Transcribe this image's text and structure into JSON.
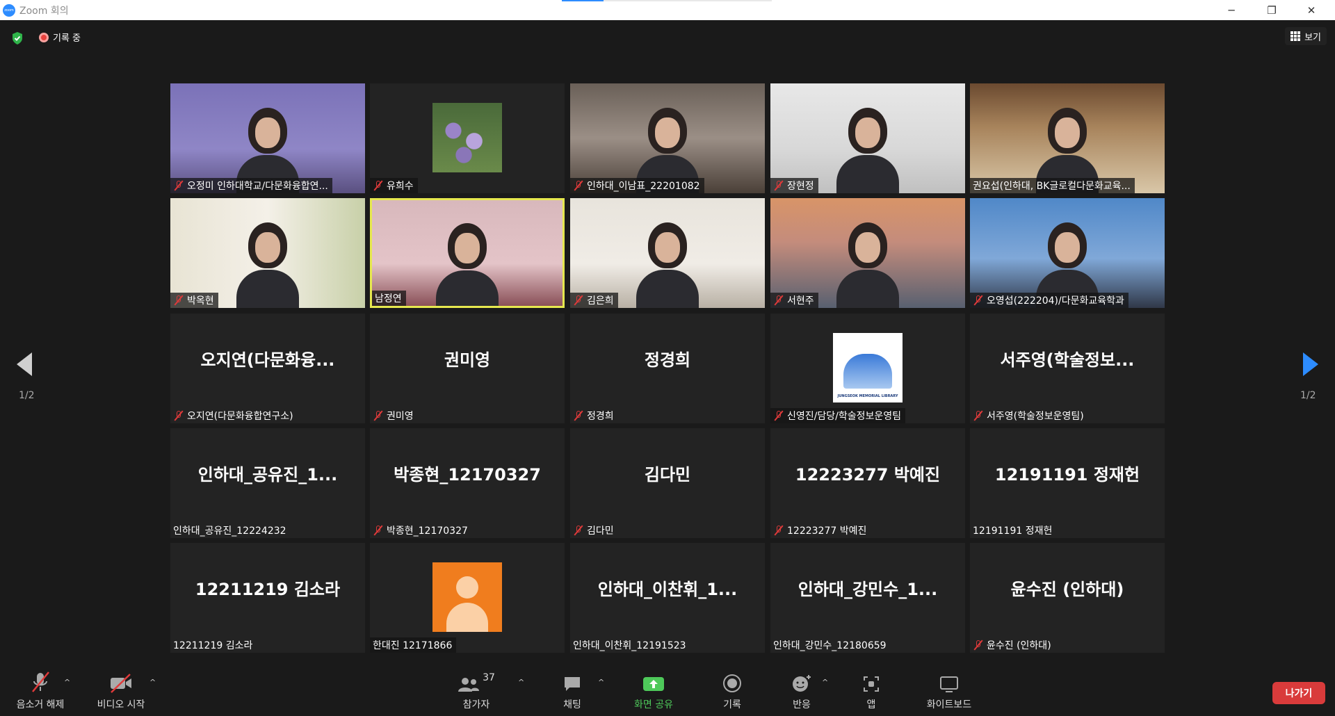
{
  "window": {
    "title": "Zoom 회의"
  },
  "topbar": {
    "recording_label": "기록 중",
    "view_label": "보기"
  },
  "pagination": {
    "left": "1/2",
    "right": "1/2"
  },
  "tiles": [
    {
      "label": "오정미 인하대학교/다문화융합연...",
      "muted": true,
      "video": true
    },
    {
      "label": "유희수",
      "muted": true,
      "image": "wisteria"
    },
    {
      "label": "인하대_이남표_22201082",
      "muted": true,
      "video": true
    },
    {
      "label": "장현정",
      "muted": true,
      "video": true
    },
    {
      "label": "권요섭(인하대, BK글로컬다문화교육...",
      "muted": false,
      "video": true
    },
    {
      "label": "박옥현",
      "muted": true,
      "video": true
    },
    {
      "label": "남정연",
      "muted": false,
      "video": true,
      "active": true
    },
    {
      "label": "김은희",
      "muted": true,
      "video": true
    },
    {
      "label": "서현주",
      "muted": true,
      "video": true
    },
    {
      "label": "오영섭(222204)/다문화교육학과",
      "muted": true,
      "video": true
    },
    {
      "center": "오지연(다문화융...",
      "label": "오지연(다문화융합연구소)",
      "muted": true
    },
    {
      "center": "권미영",
      "label": "권미영",
      "muted": true
    },
    {
      "center": "정경희",
      "label": "정경희",
      "muted": true
    },
    {
      "label": "신영진/담당/학술정보운영팀",
      "muted": true,
      "image": "library-logo",
      "logo_text": "JUNGSEOK MEMORIAL LIBRARY"
    },
    {
      "center": "서주영(학술정보...",
      "label": "서주영(학술정보운영팀)",
      "muted": true
    },
    {
      "center": "인하대_공유진_1...",
      "label": "인하대_공유진_12224232",
      "muted": false
    },
    {
      "center": "박종현_12170327",
      "label": "박종현_12170327",
      "muted": true
    },
    {
      "center": "김다민",
      "label": "김다민",
      "muted": true
    },
    {
      "center": "12223277 박예진",
      "label": "12223277 박예진",
      "muted": true
    },
    {
      "center": "12191191 정재헌",
      "label": "12191191 정재헌",
      "muted": false
    },
    {
      "center": "12211219 김소라",
      "label": "12211219 김소라",
      "muted": false
    },
    {
      "label": "한대진 12171866",
      "muted": false,
      "image": "avatar"
    },
    {
      "center": "인하대_이찬휘_1...",
      "label": "인하대_이찬휘_12191523",
      "muted": false
    },
    {
      "center": "인하대_강민수_1...",
      "label": "인하대_강민수_12180659",
      "muted": false
    },
    {
      "center": "윤수진 (인하대)",
      "label": "윤수진 (인하대)",
      "muted": true
    }
  ],
  "toolbar": {
    "audio": "음소거 해제",
    "video": "비디오 시작",
    "participants": "참가자",
    "participants_count": "37",
    "chat": "채팅",
    "share": "화면 공유",
    "record": "기록",
    "reactions": "반응",
    "apps": "앱",
    "whiteboard": "화이트보드",
    "leave": "나가기"
  },
  "colors": {
    "active_border": "#e6e84f",
    "share_green": "#4ec95a",
    "leave_red": "#d93b3b",
    "muted_red": "#e03a3a",
    "accent_blue": "#2d8cff"
  }
}
